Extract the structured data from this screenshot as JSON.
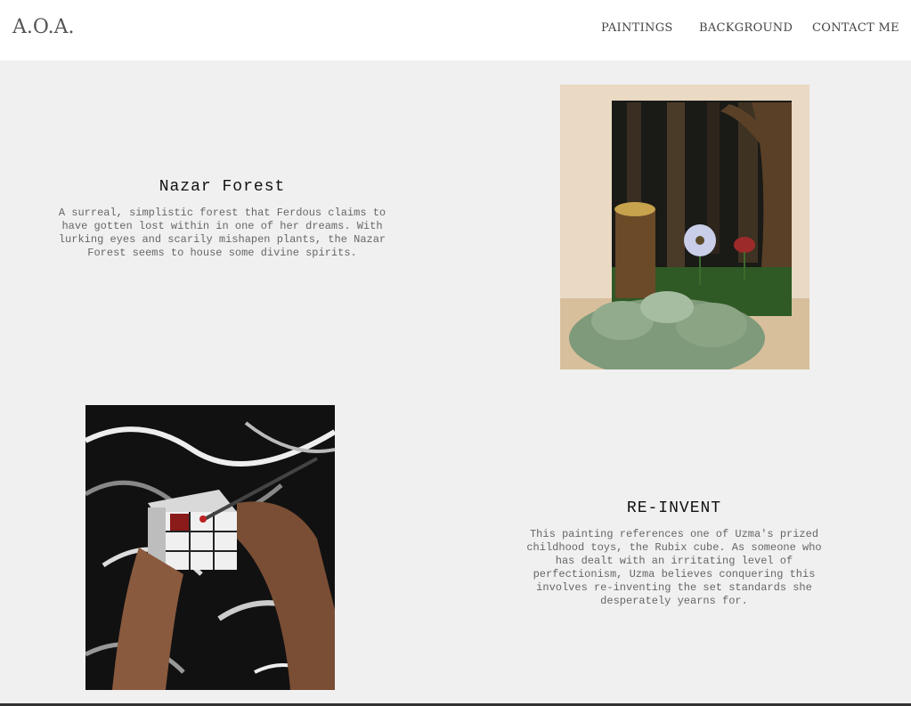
{
  "header": {
    "logo": "A.O.A.",
    "nav": [
      {
        "label": "PAINTINGS"
      },
      {
        "label": "BACKGROUND"
      },
      {
        "label": "CONTACT ME"
      }
    ]
  },
  "artworks": [
    {
      "title": "Nazar Forest",
      "description": "A surreal, simplistic forest that Ferdous claims to have gotten lost within in one of her dreams. With lurking eyes and scarily mishapen plants, the Nazar Forest seems to house some divine spirits."
    },
    {
      "title": "RE-INVENT",
      "description": "This painting references one of Uzma's prized childhood toys, the Rubix cube. As someone who has dealt with an irritating level of perfectionism, Uzma believes conquering this involves re-inventing the set standards she desperately yearns for."
    }
  ],
  "colors": {
    "page_background": "#f0f0f0",
    "header_background": "#ffffff"
  }
}
